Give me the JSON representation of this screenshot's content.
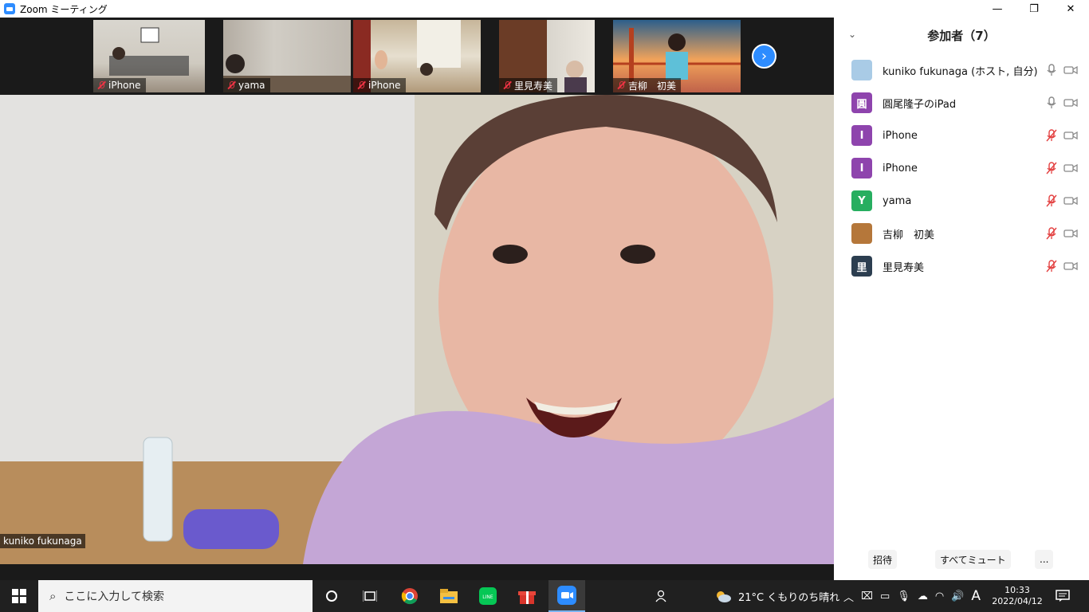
{
  "window": {
    "title": "Zoom ミーティング",
    "minimize": "—",
    "restore": "❐",
    "close": "✕"
  },
  "thumbnails": [
    {
      "label": "iPhone"
    },
    {
      "label": "yama"
    },
    {
      "label": "iPhone"
    },
    {
      "label": "里見寿美"
    },
    {
      "label": "吉柳　初美"
    }
  ],
  "next_page_icon": "chevron-right",
  "main_video": {
    "label": "kuniko fukunaga"
  },
  "participants": {
    "header": "参加者（7）",
    "list": [
      {
        "name": "kuniko fukunaga (ホスト, 自分)",
        "avatar": "",
        "avatar_color": "#a9cbe6",
        "mic": "on",
        "cam": "on"
      },
      {
        "name": "圓尾隆子のiPad",
        "avatar": "圓",
        "avatar_color": "#8e44ad",
        "mic": "on",
        "cam": "on"
      },
      {
        "name": "iPhone",
        "avatar": "I",
        "avatar_color": "#8e44ad",
        "mic": "off",
        "cam": "on"
      },
      {
        "name": "iPhone",
        "avatar": "I",
        "avatar_color": "#8e44ad",
        "mic": "off",
        "cam": "on"
      },
      {
        "name": "yama",
        "avatar": "Y",
        "avatar_color": "#27ae60",
        "mic": "off",
        "cam": "on"
      },
      {
        "name": "吉柳　初美",
        "avatar": "",
        "avatar_color": "#b5773a",
        "mic": "off",
        "cam": "on"
      },
      {
        "name": "里見寿美",
        "avatar": "里",
        "avatar_color": "#2c3e50",
        "mic": "off",
        "cam": "on"
      }
    ],
    "invite": "招待",
    "mute_all": "すべてミュート",
    "more": "..."
  },
  "taskbar": {
    "search_placeholder": "ここに入力して検索",
    "weather": "21°C  くもりのち晴れ",
    "ime": "A",
    "time": "10:33",
    "date": "2022/04/12"
  },
  "colors": {
    "accent": "#2d8cff",
    "mute_red": "#e34040"
  }
}
